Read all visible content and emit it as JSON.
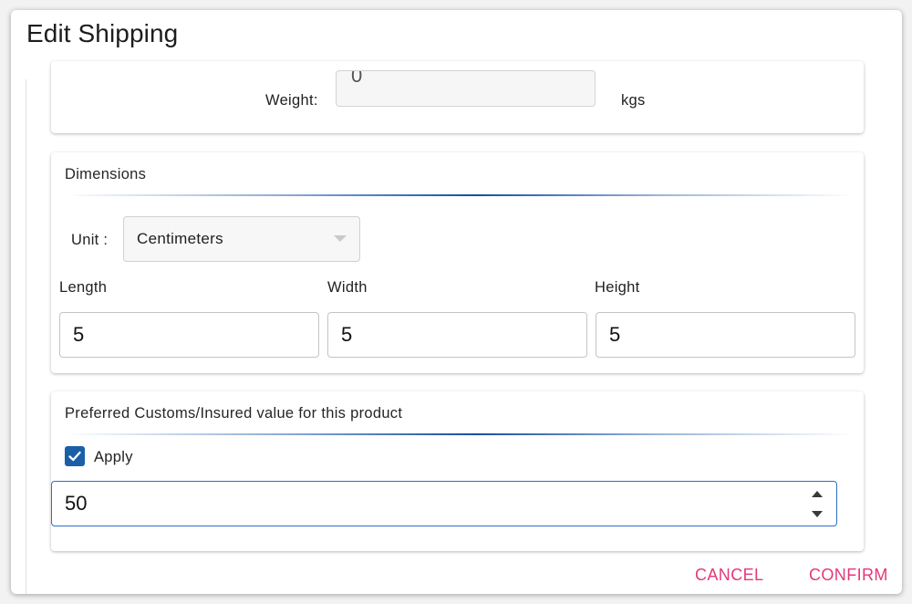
{
  "dialog": {
    "title": "Edit Shipping"
  },
  "weight": {
    "label": "Weight:",
    "value": "0",
    "unit": "kgs"
  },
  "dimensions": {
    "title": "Dimensions",
    "unit_label": "Unit :",
    "unit_value": "Centimeters",
    "length_label": "Length",
    "length_value": "5",
    "width_label": "Width",
    "width_value": "5",
    "height_label": "Height",
    "height_value": "5"
  },
  "customs": {
    "title": "Preferred Customs/Insured value for this product",
    "apply_label": "Apply",
    "apply_checked": true,
    "value": "50"
  },
  "actions": {
    "cancel_label": "CANCEL",
    "confirm_label": "CONFIRM"
  },
  "colors": {
    "accent": "#e4387a",
    "checkbox": "#1a5fa8",
    "focus_border": "#2b6fc4"
  }
}
